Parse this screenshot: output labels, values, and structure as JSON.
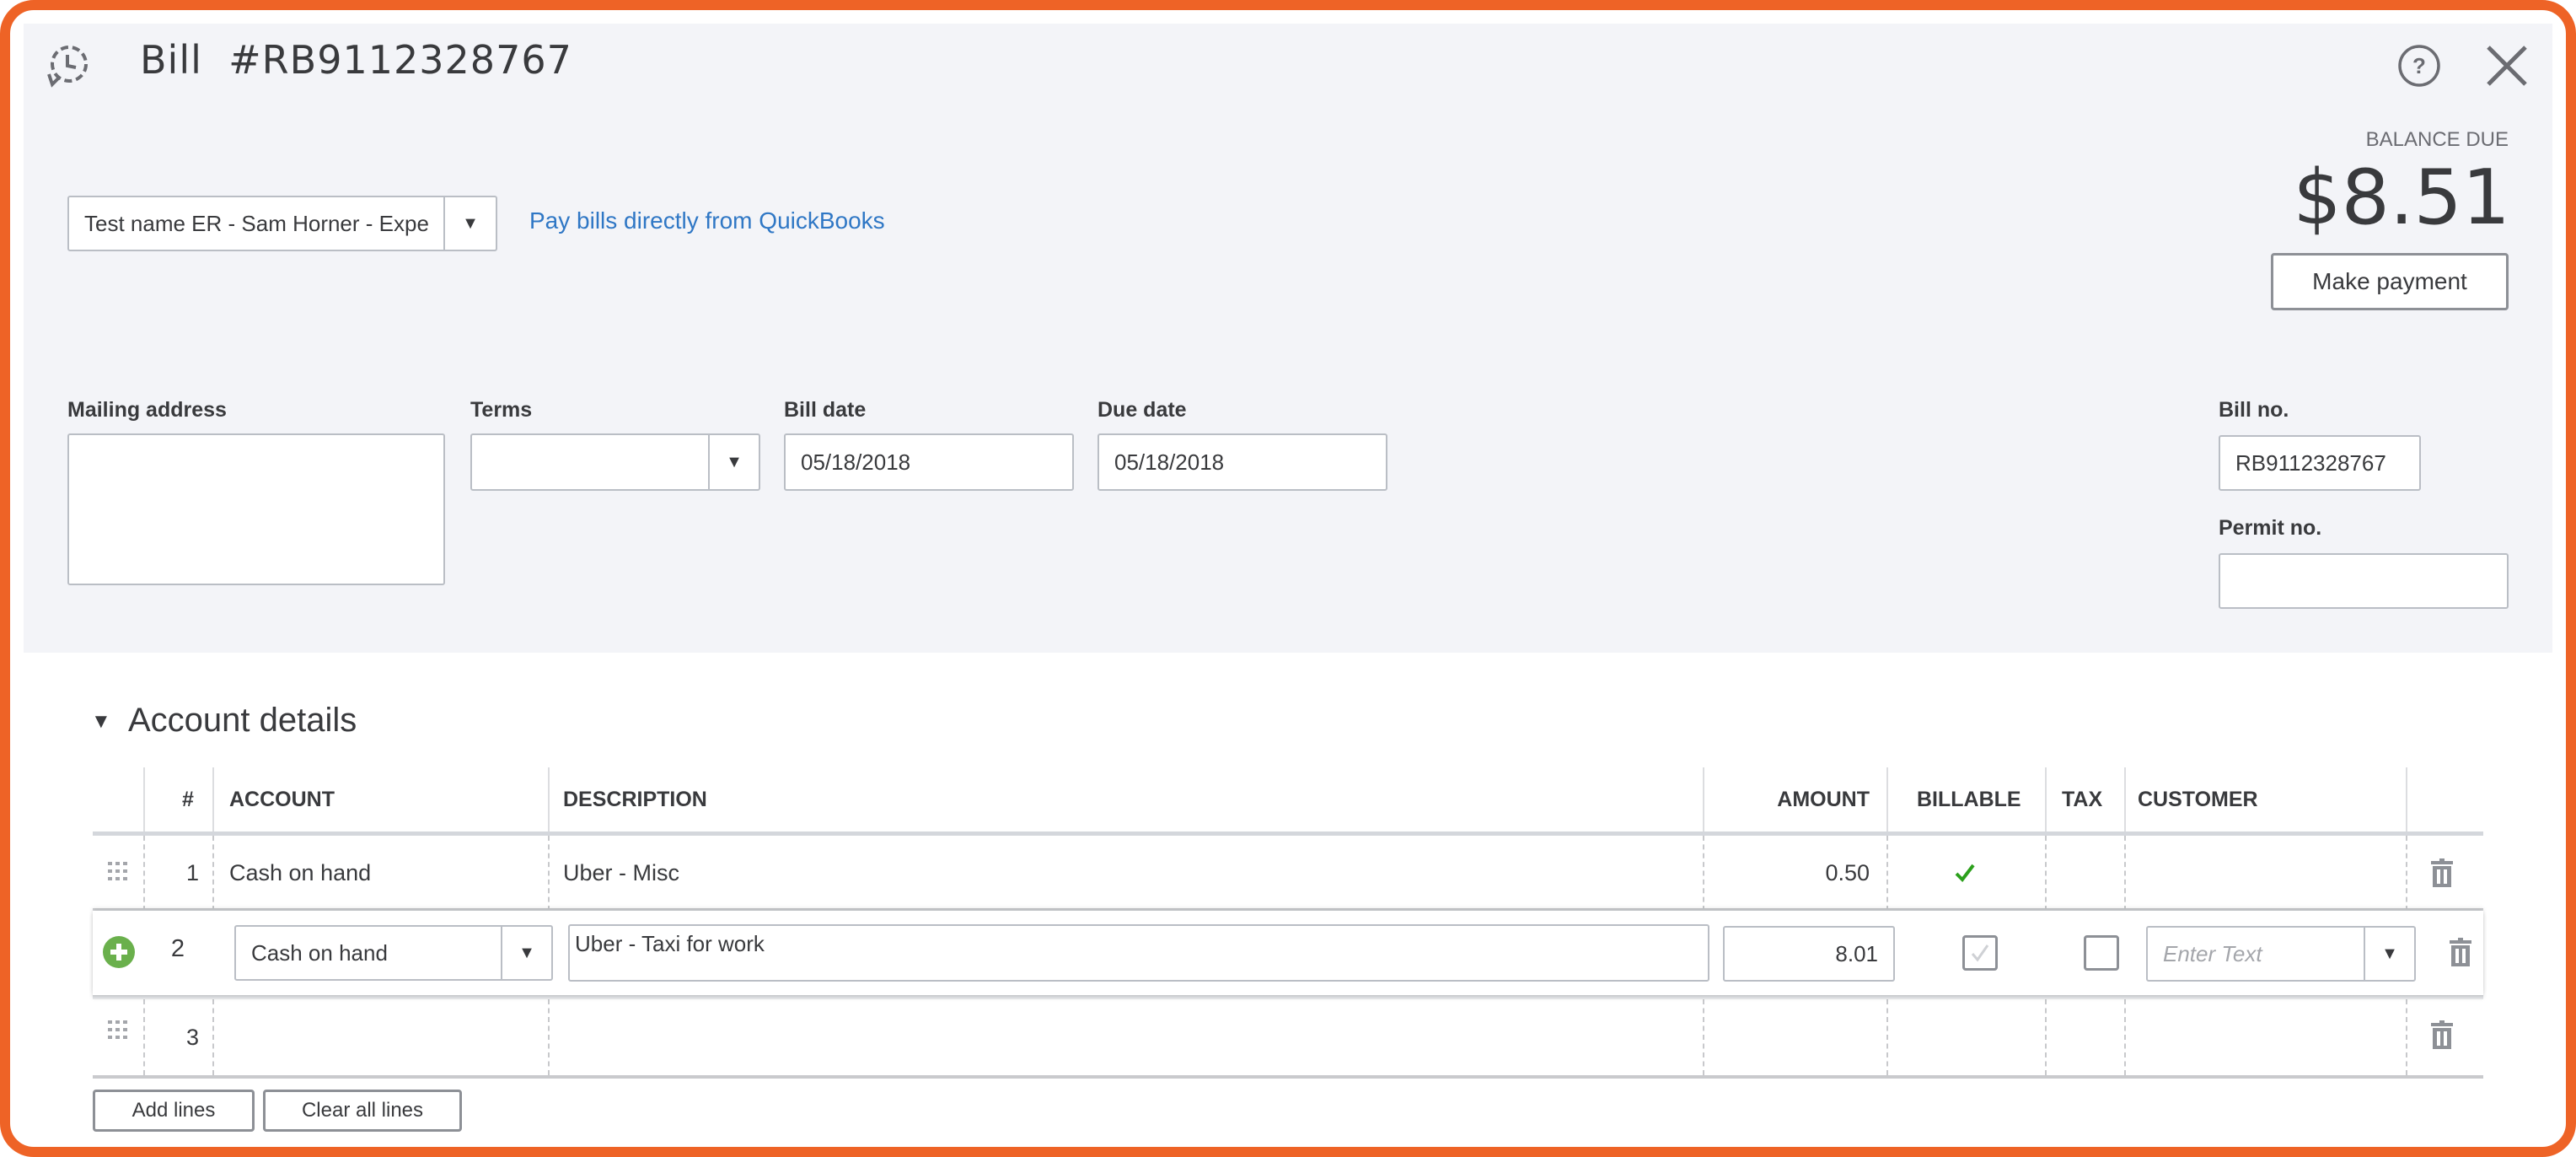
{
  "header": {
    "title": "Bill  #RB9112328767",
    "icons": {
      "history": "history-clock-icon",
      "help": "help-circle-icon",
      "close": "close-x-icon"
    }
  },
  "balance": {
    "label": "BALANCE DUE",
    "amount": "$8.51",
    "make_payment_label": "Make payment"
  },
  "vendor": {
    "value": "Test name ER - Sam Horner - Expe",
    "pay_link": "Pay bills directly from QuickBooks"
  },
  "fields": {
    "mailing_address": {
      "label": "Mailing address",
      "value": ""
    },
    "terms": {
      "label": "Terms",
      "value": ""
    },
    "bill_date": {
      "label": "Bill date",
      "value": "05/18/2018"
    },
    "due_date": {
      "label": "Due date",
      "value": "05/18/2018"
    },
    "bill_no": {
      "label": "Bill no.",
      "value": "RB9112328767"
    },
    "permit_no": {
      "label": "Permit no.",
      "value": ""
    }
  },
  "account_details": {
    "title": "Account details",
    "columns": [
      "#",
      "ACCOUNT",
      "DESCRIPTION",
      "AMOUNT",
      "BILLABLE",
      "TAX",
      "CUSTOMER"
    ],
    "rows": [
      {
        "num": "1",
        "account": "Cash on hand",
        "description": "Uber - Misc",
        "amount": "0.50",
        "billable": true,
        "tax": false,
        "customer": ""
      },
      {
        "num": "2",
        "account": "Cash on hand",
        "description": "Uber - Taxi for work",
        "amount": "8.01",
        "billable": true,
        "tax": false,
        "customer": "",
        "customer_placeholder": "Enter Text",
        "editing": true
      },
      {
        "num": "3",
        "account": "",
        "description": "",
        "amount": "",
        "billable": false,
        "tax": false,
        "customer": ""
      }
    ],
    "add_lines_label": "Add lines",
    "clear_lines_label": "Clear all lines"
  },
  "colors": {
    "accent_frame": "#ee6326",
    "link": "#2f77c5",
    "billable_check": "#2ca01c",
    "add_icon": "#6ab04c"
  }
}
